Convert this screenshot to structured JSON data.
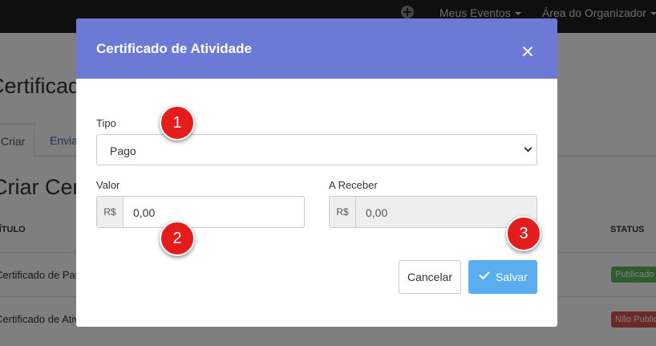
{
  "topbar": {
    "nav_items": [
      "Meus Eventos",
      "Área do Organizador"
    ]
  },
  "background": {
    "page_title": "Certificados",
    "tabs": [
      "Criar",
      "Enviar"
    ],
    "section_title": "Criar Certificado",
    "table": {
      "headers": [
        "TÍTULO",
        "STATUS"
      ],
      "rows": [
        {
          "title": "Certificado de Participação",
          "status": "Publicado",
          "status_color": "#5cb85c"
        },
        {
          "title": "Certificado de Atividade",
          "status": "Não Publicado",
          "status_color": "#d9534f"
        }
      ]
    }
  },
  "modal": {
    "title": "Certificado de Atividade",
    "tipo": {
      "label": "Tipo",
      "value": "Pago"
    },
    "valor": {
      "label": "Valor",
      "prefix": "R$",
      "value": "0,00"
    },
    "a_receber": {
      "label": "A Receber",
      "prefix": "R$",
      "value": "0,00"
    },
    "cancel_label": "Cancelar",
    "save_label": "Salvar"
  },
  "markers": [
    "1",
    "2",
    "3"
  ],
  "colors": {
    "header": "#6d7ad5",
    "save_button": "#5aaef0",
    "marker": "#e51c1c",
    "topbar": "#1e1e1e"
  }
}
